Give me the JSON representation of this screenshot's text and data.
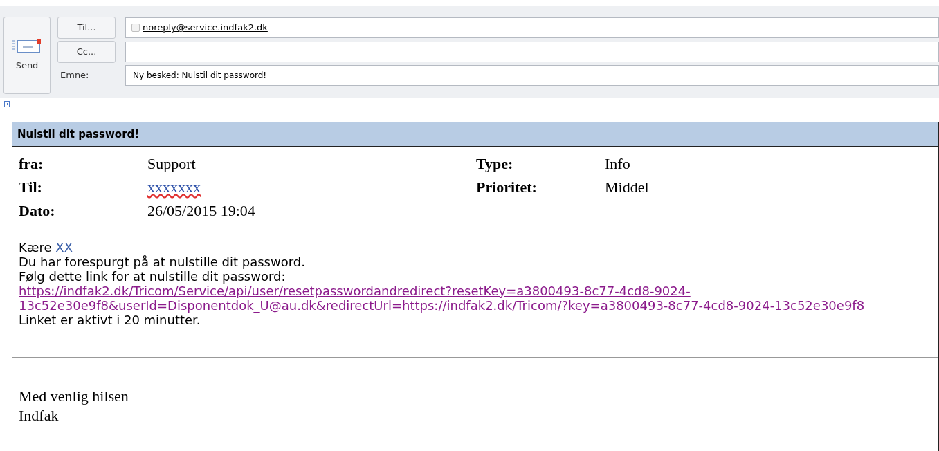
{
  "compose": {
    "send_label": "Send",
    "to_button": "Til...",
    "to_value": "noreply@service.indfak2.dk",
    "cc_button": "Cc...",
    "subject_label": "Emne:",
    "subject_value": "Ny besked: Nulstil dit password!"
  },
  "message": {
    "title": "Nulstil dit password!",
    "fields_left": [
      {
        "label": "fra:",
        "value": "Support",
        "kind": "text"
      },
      {
        "label": "Til:",
        "value": "xxxxxxx",
        "kind": "link"
      },
      {
        "label": "Dato:",
        "value": "26/05/2015 19:04",
        "kind": "text"
      }
    ],
    "fields_right": [
      {
        "label": "Type:",
        "value": "Info",
        "kind": "text"
      },
      {
        "label": "Prioritet:",
        "value": "Middel",
        "kind": "text"
      }
    ],
    "greeting": "Kære",
    "recipient": "XX",
    "lines": [
      "Du har forespurgt på at nulstille dit password.",
      "Følg dette link for at nulstille dit password:"
    ],
    "link": "https://indfak2.dk/Tricom/Service/api/user/resetpasswordandredirect?resetKey=a3800493-8c77-4cd8-9024-13c52e30e9f8&userId=Disponentdok_U@au.dk&redirectUrl=https://indfak2.dk/Tricom/?key=a3800493-8c77-4cd8-9024-13c52e30e9f8",
    "note": "Linket er aktivt i 20 minutter.",
    "closing": "Med venlig hilsen",
    "signature": "Indfak"
  }
}
